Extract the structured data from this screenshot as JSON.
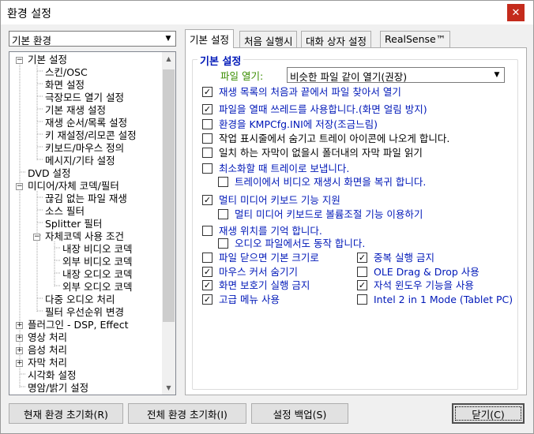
{
  "window": {
    "title": "환경 설정",
    "close_icon": "close-icon"
  },
  "profile": {
    "selected": "기본 환경"
  },
  "tree": {
    "items": [
      "기본 설정",
      "스킨/OSC",
      "화면 설정",
      "극장모드 열기  설정",
      "기본 재생 설정",
      "재생 순서/목록 설정",
      "키 재설정/리모콘 설정",
      "키보드/마우스 정의",
      "메시지/기타 설정",
      "DVD 설정",
      "미디어/자체 코덱/필터",
      "끊김 없는 파일 재생",
      "소스 필터",
      "Splitter 필터",
      "자체코덱 사용 조건",
      "내장 비디오 코덱",
      "외부 비디오 코덱",
      "내장 오디오 코덱",
      "외부 오디오 코덱",
      "다중 오디오 처리",
      "필터 우선순위 변경",
      "플러그인 - DSP, Effect",
      "영상 처리",
      "음성 처리",
      "자막 처리",
      "시각화 설정",
      "명암/밝기 설정"
    ]
  },
  "tabs": [
    "기본 설정",
    "처음 실행시",
    "대화 상자 설정",
    "RealSense™"
  ],
  "panel": {
    "group_title": "기본 설정",
    "file_open_label": "파일 열기:",
    "file_open_value": "비슷한 파일 같이 열기(권장)",
    "options": [
      {
        "label": "재생 목록의 처음과 끝에서 파일 찾아서 열기",
        "checked": true
      },
      {
        "label": "파일을 열때 쓰레드를 사용합니다.(화면 얼림 방지)",
        "checked": true
      },
      {
        "label": "환경을 KMPCfg.INI에 저장(조금느림)",
        "checked": false
      },
      {
        "label": "작업 표시줄에서 숨기고 트레이 아이콘에 나오게 합니다.",
        "checked": false
      },
      {
        "label": "일치 하는 자막이 없을시 폴더내의 자막 파일 읽기",
        "checked": false
      },
      {
        "label": "최소화할 때 트레이로 보냅니다.",
        "checked": false
      },
      {
        "label": "트레이에서 비디오 재생시 화면을 복귀 합니다.",
        "checked": false
      },
      {
        "label": "멀티 미디어 키보드 기능 지원",
        "checked": true
      },
      {
        "label": "멀티 미디어 키보드로 볼륨조절 기능 이용하기",
        "checked": false
      },
      {
        "label": "재생 위치를 기억 합니다.",
        "checked": false
      },
      {
        "label": "오디오 파일에서도 동작 합니다.",
        "checked": false
      },
      {
        "label": "파일 닫으면 기본 크기로",
        "checked": false
      },
      {
        "label": "중복 실행 금지",
        "checked": true
      },
      {
        "label": "마우스 커서 숨기기",
        "checked": true
      },
      {
        "label": "OLE Drag & Drop 사용",
        "checked": false
      },
      {
        "label": "화면 보호기 실행 금지",
        "checked": true
      },
      {
        "label": "자석 윈도우 기능을 사용",
        "checked": true
      },
      {
        "label": "고급 메뉴 사용",
        "checked": true
      },
      {
        "label": "Intel 2 in 1 Mode (Tablet PC)",
        "checked": false
      }
    ]
  },
  "buttons": {
    "reset_current": "현재 환경 초기화(R)",
    "reset_all": "전체 환경 초기화(I)",
    "backup": "설정 백업(S)",
    "close": "닫기(C)"
  }
}
